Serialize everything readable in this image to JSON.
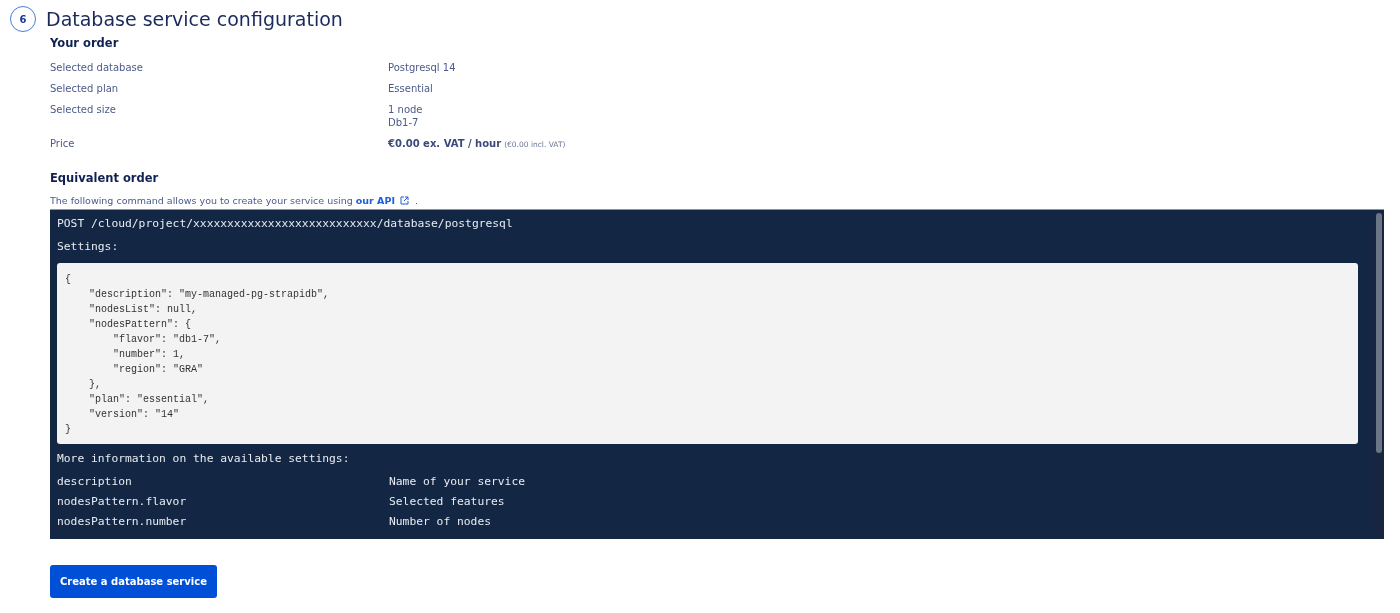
{
  "step": {
    "number": "6",
    "title": "Database service configuration"
  },
  "order": {
    "heading": "Your order",
    "rows": [
      {
        "label": "Selected database",
        "values": [
          "Postgresql 14"
        ]
      },
      {
        "label": "Selected plan",
        "values": [
          "Essential"
        ]
      },
      {
        "label": "Selected size",
        "values": [
          "1 node",
          "Db1-7"
        ]
      },
      {
        "label": "Price",
        "kind": "price",
        "values": [
          "€0.00 ex. VAT / hour"
        ],
        "note": "(€0.00 incl. VAT)"
      }
    ]
  },
  "equivalent": {
    "heading": "Equivalent order",
    "intro": "The following command allows you to create your service using",
    "link": "our API",
    "after": "."
  },
  "api": {
    "endpoint": "POST /cloud/project/xxxxxxxxxxxxxxxxxxxxxxxxxxx/database/postgresql",
    "settings_label": "Settings:",
    "code": "{\n    \"description\": \"my-managed-pg-strapidb\",\n    \"nodesList\": null,\n    \"nodesPattern\": {\n        \"flavor\": \"db1-7\",\n        \"number\": 1,\n        \"region\": \"GRA\"\n    },\n    \"plan\": \"essential\",\n    \"version\": \"14\"\n}",
    "more_label": "More information on the available settings:",
    "settings": [
      {
        "name": "description",
        "meaning": "Name of your service"
      },
      {
        "name": "nodesPattern.flavor",
        "meaning": "Selected features"
      },
      {
        "name": "nodesPattern.number",
        "meaning": "Number of nodes"
      }
    ]
  },
  "button": "Create a database service"
}
